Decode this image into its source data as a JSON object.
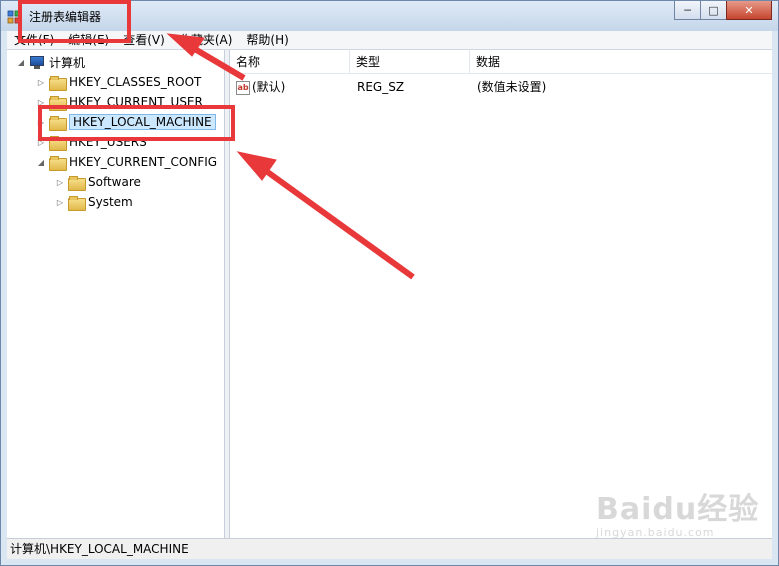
{
  "window": {
    "title": "注册表编辑器",
    "minimize": "─",
    "maximize": "□",
    "close": "✕"
  },
  "menu": [
    "文件(F)",
    "编辑(E)",
    "查看(V)",
    "收藏夹(A)",
    "帮助(H)"
  ],
  "tree": {
    "root": "计算机",
    "items": [
      {
        "label": "HKEY_CLASSES_ROOT",
        "expander": "▷"
      },
      {
        "label": "HKEY_CURRENT_USER",
        "expander": "▷"
      },
      {
        "label": "HKEY_LOCAL_MACHINE",
        "expander": "▷",
        "selected": true
      },
      {
        "label": "HKEY_USERS",
        "expander": "▷"
      },
      {
        "label": "HKEY_CURRENT_CONFIG",
        "expander": "◢"
      }
    ],
    "children": [
      {
        "label": "Software",
        "expander": "▷"
      },
      {
        "label": "System",
        "expander": "▷"
      }
    ],
    "root_expander": "◢"
  },
  "list": {
    "columns": [
      "名称",
      "类型",
      "数据"
    ],
    "rows": [
      {
        "icon": "ab",
        "name": "(默认)",
        "type": "REG_SZ",
        "data": "(数值未设置)"
      }
    ]
  },
  "status": "计算机\\HKEY_LOCAL_MACHINE",
  "watermark": {
    "brand": "Baidu经验",
    "url": "jingyan.baidu.com"
  },
  "colors": {
    "annotation": "#e8383a",
    "selection": "#cce8ff"
  }
}
